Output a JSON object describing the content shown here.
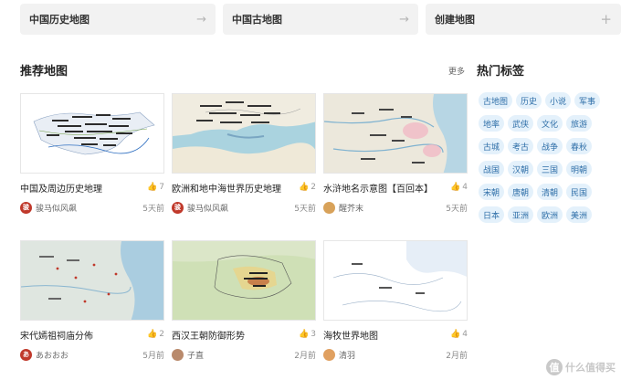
{
  "top_links": [
    {
      "label": "中国历史地图",
      "icon": "arrow-right-icon"
    },
    {
      "label": "中国古地图",
      "icon": "arrow-right-icon"
    },
    {
      "label": "创建地图",
      "icon": "plus-icon"
    }
  ],
  "recommended": {
    "title": "推荐地图",
    "more_label": "更多",
    "cards": [
      {
        "title": "中国及周边历史地理",
        "likes": "7",
        "author": "骏马似风飙",
        "time": "5天前",
        "avatar_text": "骏",
        "avatar_color": "#c0392b"
      },
      {
        "title": "欧洲和地中海世界历史地理",
        "likes": "2",
        "author": "骏马似风飙",
        "time": "5天前",
        "avatar_text": "骏",
        "avatar_color": "#c0392b"
      },
      {
        "title": "水浒地名示意图【百回本】",
        "likes": "4",
        "author": "醒芥末",
        "time": "5天前",
        "avatar_text": "",
        "avatar_color": "#d8a25a"
      },
      {
        "title": "宋代嫣祖祠庙分佈",
        "likes": "2",
        "author": "あおおお",
        "time": "5月前",
        "avatar_text": "あ",
        "avatar_color": "#c0392b"
      },
      {
        "title": "西汉王朝防御形势",
        "likes": "3",
        "author": "子直",
        "time": "2月前",
        "avatar_text": "",
        "avatar_color": "#b98a6c"
      },
      {
        "title": "海牧世界地图",
        "likes": "4",
        "author": "清羽",
        "time": "2月前",
        "avatar_text": "",
        "avatar_color": "#e0a060"
      }
    ]
  },
  "hot_tags": {
    "title": "热门标签",
    "tags": [
      "古地图",
      "历史",
      "小说",
      "军事",
      "地率",
      "武侠",
      "文化",
      "旅游",
      "古城",
      "考古",
      "战争",
      "春秋",
      "战国",
      "汉朝",
      "三国",
      "明朝",
      "宋朝",
      "唐朝",
      "清朝",
      "民国",
      "日本",
      "亚洲",
      "欧洲",
      "美洲"
    ]
  },
  "watermark": {
    "badge": "值",
    "text": "什么值得买"
  },
  "colors": {
    "tag_bg": "#e4f1fb",
    "tag_text": "#2f6fa8",
    "button_bg": "#f2f2f2"
  }
}
